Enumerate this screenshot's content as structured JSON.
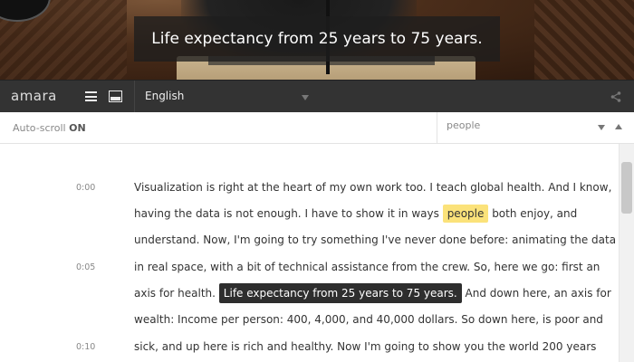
{
  "video": {
    "subtitle": "Life expectancy from 25 years to 75 years."
  },
  "toolbar": {
    "logo": "amara",
    "language": "English",
    "icons": [
      "menu-icon",
      "subtitles-icon",
      "chevron-down-icon",
      "share-icon"
    ]
  },
  "controls": {
    "autoscroll_label": "Auto-scroll",
    "autoscroll_state": "ON",
    "search_value": "people"
  },
  "transcript": {
    "highlight_color": "#fbe27a",
    "lines": [
      {
        "time": "0:00",
        "text": "Visualization is right at the heart of my own work too. I teach global health. And I know,"
      },
      {
        "time": "",
        "pre": "having the data is not enough. I have to show it in ways ",
        "highlight": "people",
        "post": " both enjoy, and"
      },
      {
        "time": "",
        "text": "understand. Now, I'm going to try something I've never done before: animating the data"
      },
      {
        "time": "0:05",
        "text": "in real space, with a bit of technical assistance from the crew. So, here we go: first an"
      },
      {
        "time": "",
        "pre": "axis for health. ",
        "current": "Life expectancy from 25 years to 75 years.",
        "post": " And down here, an axis for"
      },
      {
        "time": "",
        "text": "wealth: Income per person: 400, 4,000, and 40,000 dollars. So down here, is poor and"
      },
      {
        "time": "0:10",
        "text": "sick, and up here is rich and healthy. Now I'm going to show you the world 200 years"
      }
    ]
  }
}
